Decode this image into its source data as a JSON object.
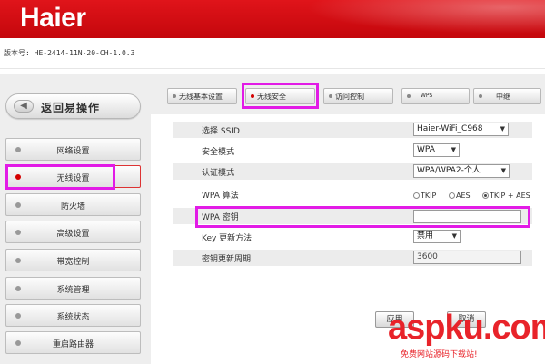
{
  "header": {
    "logo": "Haier"
  },
  "version": "版本号: HE-2414-11N-20-CH-1.0.3",
  "sidebar": {
    "back_label": "返回易操作",
    "items": [
      {
        "label": "网络设置"
      },
      {
        "label": "无线设置"
      },
      {
        "label": "防火墙"
      },
      {
        "label": "高级设置"
      },
      {
        "label": "带宽控制"
      },
      {
        "label": "系统管理"
      },
      {
        "label": "系统状态"
      },
      {
        "label": "重启路由器"
      }
    ]
  },
  "tabs": [
    {
      "label": "无线基本设置"
    },
    {
      "label": "无线安全"
    },
    {
      "label": "访问控制"
    },
    {
      "label": "WPS"
    },
    {
      "label": "中继"
    }
  ],
  "form": {
    "ssid": {
      "label": "选择 SSID",
      "value": "Haier-WiFi_C968"
    },
    "security_mode": {
      "label": "安全模式",
      "value": "WPA"
    },
    "auth_mode": {
      "label": "认证模式",
      "value": "WPA/WPA2-个人"
    },
    "wpa_algo": {
      "label": "WPA 算法",
      "options": [
        "TKIP",
        "AES",
        "TKIP + AES"
      ],
      "selected": "TKIP + AES"
    },
    "wpa_key": {
      "label": "WPA 密钥",
      "value": ""
    },
    "key_update": {
      "label": "Key 更新方法",
      "value": "禁用"
    },
    "key_period": {
      "label": "密钥更新周期",
      "value": "3600"
    }
  },
  "buttons": {
    "apply": "应用",
    "cancel": "取消"
  },
  "watermark": {
    "text": "aspku.com",
    "sub": "免费网站源码下载站!"
  },
  "colors": {
    "header_red": "#d20d12",
    "highlight": "#e21be6",
    "active_dot": "#d40000"
  }
}
